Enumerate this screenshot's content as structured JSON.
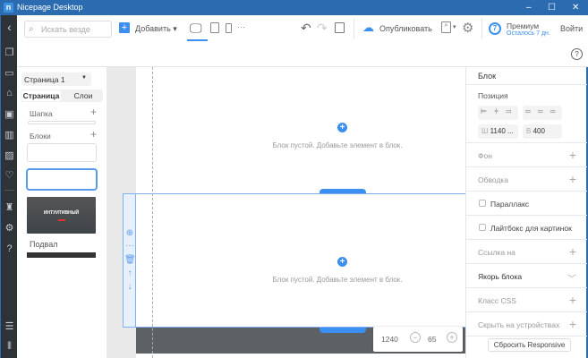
{
  "window": {
    "title": "Nicepage Desktop",
    "logo": "n",
    "controls": [
      "minimize",
      "maximize",
      "close"
    ]
  },
  "toolbar": {
    "search_placeholder": "Искать везде",
    "add_label": "Добавить",
    "devices": [
      "desktop",
      "tablet",
      "phone"
    ],
    "more": "···",
    "publish_label": "Опубликовать",
    "premium_title": "Премиум",
    "premium_sub": "Осталось 7 дн.",
    "premium_badge": "7",
    "login_label": "Войти"
  },
  "left_panel": {
    "page_select": "Страница 1",
    "tabs": [
      "Страница",
      "Слои"
    ],
    "header_label": "Шапка",
    "blocks_label": "Блоки",
    "footer_label": "Подвал",
    "thumb_title": "ИНТУИТИВНЫЙ"
  },
  "canvas": {
    "empty_text": "Блок пустой. Добавьте элемент в блок.",
    "width_value": "1240",
    "zoom_value": "65"
  },
  "right_panel": {
    "title": "Блок",
    "position_label": "Позиция",
    "width_prefix": "Ш",
    "width_value": "1140 ...",
    "height_prefix": "В",
    "height_value": "400",
    "background": "Фон",
    "border": "Обводка",
    "parallax": "Параллакс",
    "lightbox": "Лайтбокс для картинок",
    "link": "Ссылка на",
    "anchor": "Якорь блока",
    "css_class": "Класс CSS",
    "hide_devices": "Скрыть на устройствах",
    "reset": "Сбросить Responsive"
  },
  "colors": {
    "accent": "#3b8ff0",
    "titlebar": "#2b6cb0",
    "sidebar": "#2e3338"
  }
}
